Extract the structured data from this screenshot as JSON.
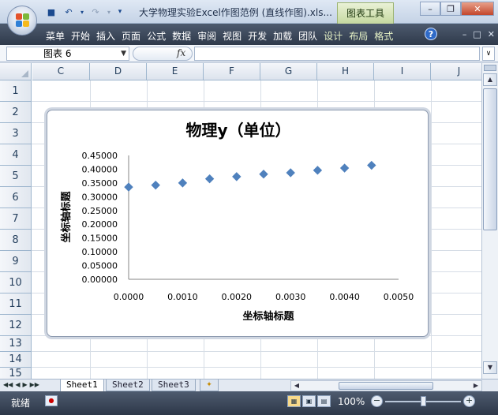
{
  "window": {
    "title": "大学物理实验Excel作图范例 (直线作图).xls...",
    "context_tab": "图表工具"
  },
  "ribbon": {
    "tabs": [
      {
        "label": "菜单"
      },
      {
        "label": "开始"
      },
      {
        "label": "插入"
      },
      {
        "label": "页面"
      },
      {
        "label": "公式"
      },
      {
        "label": "数据"
      },
      {
        "label": "审阅"
      },
      {
        "label": "视图"
      },
      {
        "label": "开发"
      },
      {
        "label": "加载"
      },
      {
        "label": "团队"
      },
      {
        "label": "设计"
      },
      {
        "label": "布局"
      },
      {
        "label": "格式"
      }
    ]
  },
  "formula_bar": {
    "name_box": "图表 6",
    "fx_label": "fx",
    "formula": ""
  },
  "grid": {
    "columns": [
      "C",
      "D",
      "E",
      "F",
      "G",
      "H",
      "I",
      "J"
    ],
    "rows": [
      "1",
      "2",
      "3",
      "4",
      "5",
      "6",
      "7",
      "8",
      "9",
      "10",
      "11",
      "12",
      "13",
      "14",
      "15"
    ]
  },
  "sheets": {
    "tabs": [
      "Sheet1",
      "Sheet2",
      "Sheet3"
    ],
    "active": "Sheet1"
  },
  "status": {
    "ready": "就绪",
    "zoom": "100%"
  },
  "colors": {
    "marker": "#4f81bd",
    "ribbon_bg": "#3b4658"
  },
  "chart_data": {
    "type": "scatter",
    "title": "物理y（单位）",
    "xlabel": "坐标轴标题",
    "ylabel": "坐标轴标题",
    "xlim": [
      0,
      0.005
    ],
    "ylim": [
      0,
      0.45
    ],
    "x_ticks": [
      "0.0000",
      "0.0010",
      "0.0020",
      "0.0030",
      "0.0040",
      "0.0050"
    ],
    "y_ticks": [
      "0.00000",
      "0.05000",
      "0.10000",
      "0.15000",
      "0.20000",
      "0.25000",
      "0.30000",
      "0.35000",
      "0.40000",
      "0.45000"
    ],
    "grid": false,
    "legend": "none",
    "series": [
      {
        "x": [
          0.0,
          0.0005,
          0.001,
          0.0015,
          0.002,
          0.0025,
          0.003,
          0.0035,
          0.004,
          0.0045
        ],
        "y": [
          0.335,
          0.342,
          0.35,
          0.365,
          0.373,
          0.382,
          0.387,
          0.396,
          0.404,
          0.414
        ]
      }
    ]
  }
}
